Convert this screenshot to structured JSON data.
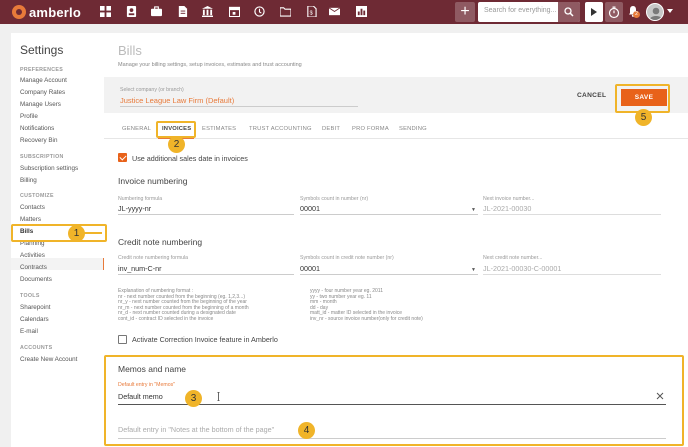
{
  "app": {
    "logo_text": "amberlo"
  },
  "topbar": {
    "nav_icons": [
      "dashboard-icon",
      "contacts-icon",
      "briefcase-icon",
      "document-icon",
      "bank-icon",
      "calendar-icon",
      "history-icon",
      "folder-icon",
      "invoice-icon",
      "mail-icon",
      "chart-icon"
    ],
    "add_label": "+",
    "search_placeholder": "Search for everything...",
    "notification_count": "2"
  },
  "sidebar": {
    "title": "Settings",
    "sections": [
      {
        "label": "PREFERENCES",
        "items": [
          "Manage Account",
          "Company Rates",
          "Manage Users",
          "Profile",
          "Notifications",
          "Recovery Bin"
        ]
      },
      {
        "label": "SUBSCRIPTION",
        "items": [
          "Subscription settings",
          "Billing"
        ]
      },
      {
        "label": "CUSTOMIZE",
        "items": [
          "Contacts",
          "Matters",
          "Bills",
          "Planning",
          "Activities",
          "Contracts",
          "Documents"
        ]
      },
      {
        "label": "TOOLS",
        "items": [
          "Sharepoint",
          "Calendars",
          "E-mail"
        ]
      },
      {
        "label": "ACCOUNTS",
        "items": [
          "Create New Account"
        ]
      }
    ]
  },
  "main": {
    "title": "Bills",
    "subtitle": "Manage your billing settings, setup invoices, estimates and trust accounting",
    "company_label": "Select company (or branch)",
    "company_value": "Justice League Law Firm (Default)",
    "cancel_label": "CANCEL",
    "save_label": "SAVE",
    "tabs": [
      "GENERAL",
      "INVOICES",
      "ESTIMATES",
      "TRUST ACCOUNTING",
      "DEBIT",
      "PRO FORMA",
      "SENDING"
    ],
    "active_tab": "INVOICES",
    "use_sales_date_label": "Use additional sales date in invoices",
    "use_sales_date_checked": true,
    "invoice_numbering": {
      "heading": "Invoice numbering",
      "formula_label": "Numbering formula",
      "formula_value": "JL-yyyy-nr",
      "symbols_label": "Symbols count in number (nr)",
      "symbols_value": "00001",
      "next_label": "Next invoice number...",
      "next_value": "JL-2021-00030"
    },
    "credit_note_numbering": {
      "heading": "Credit note numbering",
      "formula_label": "Credit note numbering formula",
      "formula_value": "inv_num-C-nr",
      "symbols_label": "Symbols count in credit note number (nr)",
      "symbols_value": "00001",
      "next_label": "Next credit note number...",
      "next_value": "JL-2021-00030-C-00001"
    },
    "explanation_left": "Explanation of numbering format :\nnr - next number counted from the beginning (eg. 1,2,3...)\nnr_y - next number counted from the beginning of the year\nnr_m - next number counted from the beginning of a month\nnr_d - next number counted during a designated date\ncont_id - contract ID selected in the invoice",
    "explanation_right": "yyyy - four number year eg. 2011\nyy - two number year eg. 11\nmm - month\ndd - day\nmatt_id - matter ID selected in the invoice\ninv_nr - source invoice number(only for credit note)",
    "correction_label": "Activate Correction Invoice feature in Amberlo",
    "correction_checked": false,
    "memos": {
      "heading": "Memos and name",
      "memo_label": "Default entry in \"Memos\"",
      "memo_value": "Default memo",
      "notes_placeholder": "Default entry in \"Notes at the bottom of the page\""
    }
  },
  "annotations": [
    "1",
    "2",
    "3",
    "4",
    "5"
  ],
  "colors": {
    "topbar": "#6e2a34",
    "accent": "#e87a3a",
    "save": "#e8621a",
    "highlight": "#f0b429"
  }
}
